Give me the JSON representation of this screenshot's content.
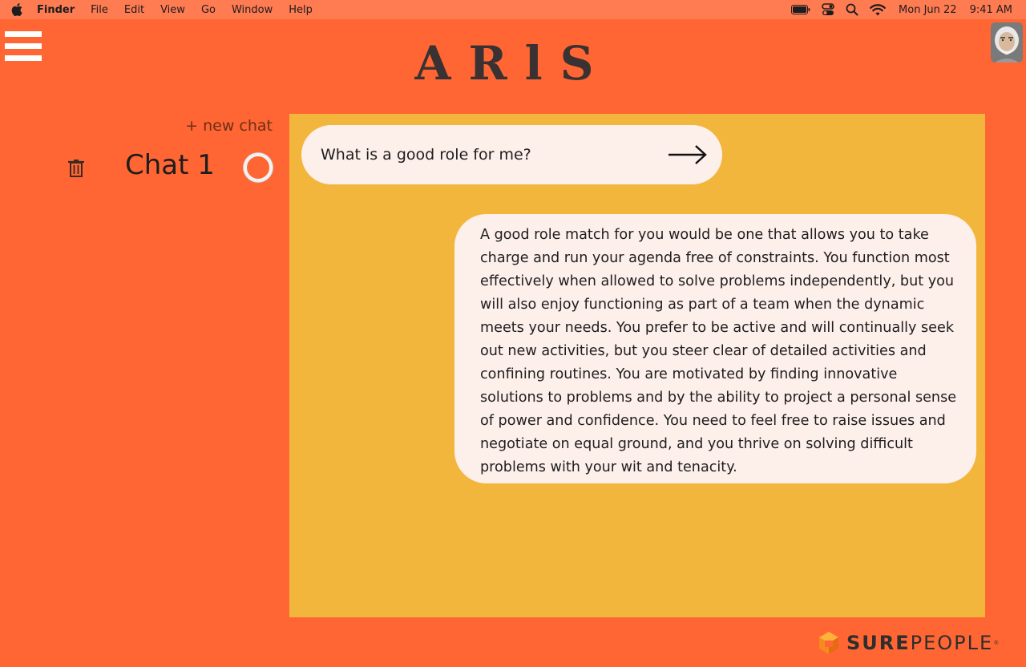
{
  "menubar": {
    "app_name": "Finder",
    "items": [
      "File",
      "Edit",
      "View",
      "Go",
      "Window",
      "Help"
    ],
    "date": "Mon Jun 22",
    "time": "9:41 AM",
    "status_icons": [
      "battery-icon",
      "control-center-icon",
      "spotlight-search-icon",
      "wifi-icon"
    ]
  },
  "header": {
    "title": "ARlS",
    "menu_icon": "hamburger-menu-icon",
    "avatar": "user-avatar"
  },
  "sidebar": {
    "new_chat_label": "+ new chat",
    "chats": [
      {
        "name": "Chat 1",
        "delete_icon": "trash-icon"
      }
    ]
  },
  "chat": {
    "question": "What is a good role for me?",
    "send_icon": "arrow-right-icon",
    "answer": "A good role match for you would be one that allows you to take charge and run your agenda free of constraints. You function most effectively when allowed to solve problems independently, but you will also enjoy functioning as part of a team when the dynamic meets your needs. You prefer to be active and will continually seek out new activities, but you steer clear of detailed activities and confining routines. You are motivated by finding innovative solutions to problems and by the ability to project a personal sense of power and confidence. You need to feel free to raise issues and negotiate on equal ground, and you thrive on solving difficult problems with your wit and tenacity."
  },
  "footer": {
    "logo_bold": "SURE",
    "logo_light": "PEOPLE",
    "logo_mark": "surepeople-logo-icon"
  },
  "colors": {
    "background": "#ff6633",
    "panel": "#f2b63c",
    "bubble": "#fdefea",
    "text_dark": "#2b2b2b"
  }
}
